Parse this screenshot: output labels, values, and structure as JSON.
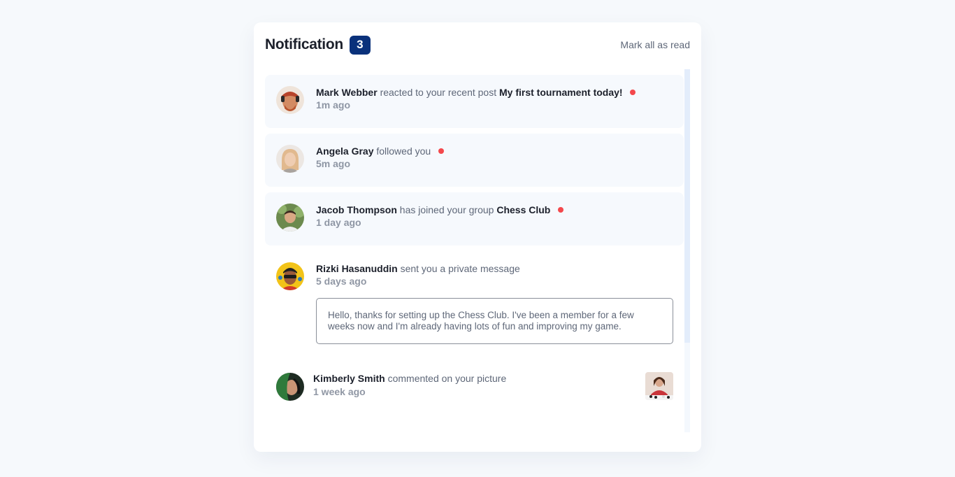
{
  "header": {
    "title": "Notification",
    "unread_count": "3",
    "mark_all_label": "Mark all as read"
  },
  "notifications": [
    {
      "name": "Mark Webber",
      "action": "reacted to your recent post",
      "target": "My first tournament today!",
      "time": "1m ago",
      "unread": true,
      "avatar_color": "#c9765a"
    },
    {
      "name": "Angela Gray",
      "action": "followed you",
      "target": "",
      "time": "5m ago",
      "unread": true,
      "avatar_color": "#d7b59a"
    },
    {
      "name": "Jacob Thompson",
      "action": "has joined your group",
      "target": "Chess Club",
      "time": "1 day ago",
      "unread": true,
      "avatar_color": "#4f6a3f"
    },
    {
      "name": "Rizki Hasanuddin",
      "action": "sent you a private message",
      "target": "",
      "time": "5 days ago",
      "unread": false,
      "avatar_color": "#f2c318",
      "message": "Hello, thanks for setting up the Chess Club. I've been a member for a few weeks now and I'm already having lots of fun and improving my game."
    },
    {
      "name": "Kimberly Smith",
      "action": "commented on your picture",
      "target": "",
      "time": "1 week ago",
      "unread": false,
      "avatar_color": "#2f6b3a",
      "thumbnail": "chess-photo"
    }
  ]
}
